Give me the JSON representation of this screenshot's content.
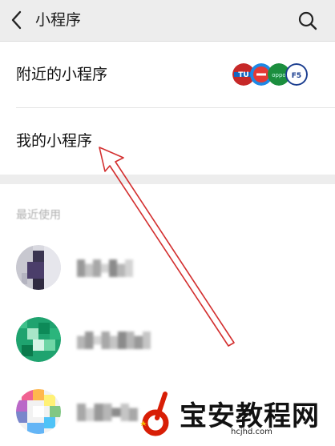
{
  "header": {
    "title": "小程序",
    "back_icon": "chevron-left-icon",
    "search_icon": "search-icon"
  },
  "list": [
    {
      "label": "附近的小程序"
    },
    {
      "label": "我的小程序"
    }
  ],
  "recent": {
    "section_title": "最近使用",
    "items": [
      {
        "avatar": "pixelated-avatar"
      },
      {
        "avatar": "pixelated-avatar"
      },
      {
        "avatar": "pixelated-avatar"
      }
    ]
  },
  "colors": {
    "background": "#ededed",
    "panel": "#ffffff",
    "arrow": "#d32f2f",
    "watermark_red": "#d81e06"
  },
  "watermark": {
    "text": "宝安教程网",
    "domain": "hcjhd.com"
  }
}
